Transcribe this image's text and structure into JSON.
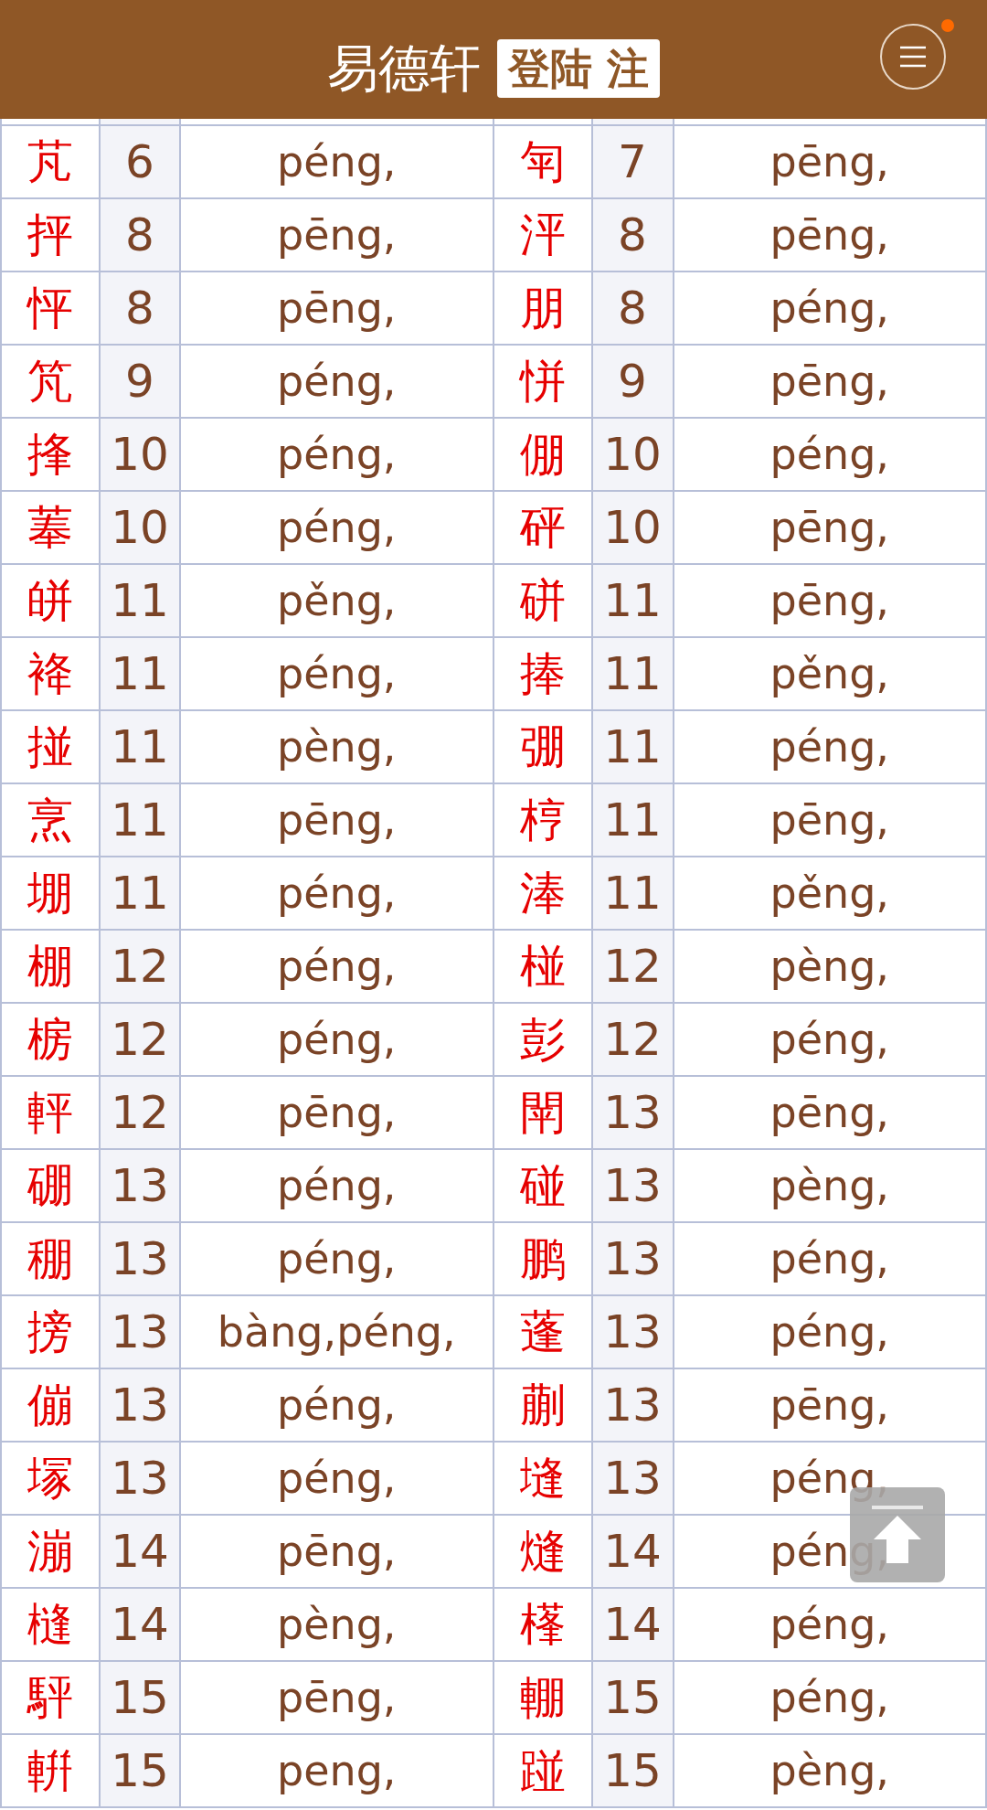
{
  "header": {
    "title": "易德轩",
    "login_label": "登陆 注",
    "menu_badge": true
  },
  "entries": [
    {
      "char": "芃",
      "strokes": "6",
      "pinyin": "péng,"
    },
    {
      "char": "匉",
      "strokes": "7",
      "pinyin": "pēng,"
    },
    {
      "char": "抨",
      "strokes": "8",
      "pinyin": "pēng,"
    },
    {
      "char": "泙",
      "strokes": "8",
      "pinyin": "pēng,"
    },
    {
      "char": "怦",
      "strokes": "8",
      "pinyin": "pēng,"
    },
    {
      "char": "朋",
      "strokes": "8",
      "pinyin": "péng,"
    },
    {
      "char": "竼",
      "strokes": "9",
      "pinyin": "péng,"
    },
    {
      "char": "恲",
      "strokes": "9",
      "pinyin": "pēng,"
    },
    {
      "char": "捀",
      "strokes": "10",
      "pinyin": "péng,"
    },
    {
      "char": "倗",
      "strokes": "10",
      "pinyin": "péng,"
    },
    {
      "char": "菶",
      "strokes": "10",
      "pinyin": "péng,"
    },
    {
      "char": "砰",
      "strokes": "10",
      "pinyin": "pēng,"
    },
    {
      "char": "皏",
      "strokes": "11",
      "pinyin": "pěng,"
    },
    {
      "char": "硑",
      "strokes": "11",
      "pinyin": "pēng,"
    },
    {
      "char": "袶",
      "strokes": "11",
      "pinyin": "péng,"
    },
    {
      "char": "捧",
      "strokes": "11",
      "pinyin": "pěng,"
    },
    {
      "char": "掽",
      "strokes": "11",
      "pinyin": "pèng,"
    },
    {
      "char": "弸",
      "strokes": "11",
      "pinyin": "péng,"
    },
    {
      "char": "烹",
      "strokes": "11",
      "pinyin": "pēng,"
    },
    {
      "char": "梈",
      "strokes": "11",
      "pinyin": "pēng,"
    },
    {
      "char": "堋",
      "strokes": "11",
      "pinyin": "péng,"
    },
    {
      "char": "淎",
      "strokes": "11",
      "pinyin": "pěng,"
    },
    {
      "char": "棚",
      "strokes": "12",
      "pinyin": "péng,"
    },
    {
      "char": "椪",
      "strokes": "12",
      "pinyin": "pèng,"
    },
    {
      "char": "椖",
      "strokes": "12",
      "pinyin": "péng,"
    },
    {
      "char": "彭",
      "strokes": "12",
      "pinyin": "péng,"
    },
    {
      "char": "軯",
      "strokes": "12",
      "pinyin": "pēng,"
    },
    {
      "char": "閛",
      "strokes": "13",
      "pinyin": "pēng,"
    },
    {
      "char": "硼",
      "strokes": "13",
      "pinyin": "péng,"
    },
    {
      "char": "碰",
      "strokes": "13",
      "pinyin": "pèng,"
    },
    {
      "char": "稝",
      "strokes": "13",
      "pinyin": "péng,"
    },
    {
      "char": "鹏",
      "strokes": "13",
      "pinyin": "péng,"
    },
    {
      "char": "搒",
      "strokes": "13",
      "pinyin": "bàng,péng,"
    },
    {
      "char": "蓬",
      "strokes": "13",
      "pinyin": "péng,"
    },
    {
      "char": "傰",
      "strokes": "13",
      "pinyin": "péng,"
    },
    {
      "char": "蒯",
      "strokes": "13",
      "pinyin": "pēng,"
    },
    {
      "char": "塜",
      "strokes": "13",
      "pinyin": "péng,"
    },
    {
      "char": "塳",
      "strokes": "13",
      "pinyin": "péng,"
    },
    {
      "char": "漰",
      "strokes": "14",
      "pinyin": "pēng,"
    },
    {
      "char": "熢",
      "strokes": "14",
      "pinyin": "péng,"
    },
    {
      "char": "槰",
      "strokes": "14",
      "pinyin": "pèng,"
    },
    {
      "char": "樥",
      "strokes": "14",
      "pinyin": "péng,"
    },
    {
      "char": "駍",
      "strokes": "15",
      "pinyin": "pēng,"
    },
    {
      "char": "輣",
      "strokes": "15",
      "pinyin": "péng,"
    },
    {
      "char": "輧",
      "strokes": "15",
      "pinyin": "peng,"
    },
    {
      "char": "踫",
      "strokes": "15",
      "pinyin": "pèng,"
    }
  ]
}
